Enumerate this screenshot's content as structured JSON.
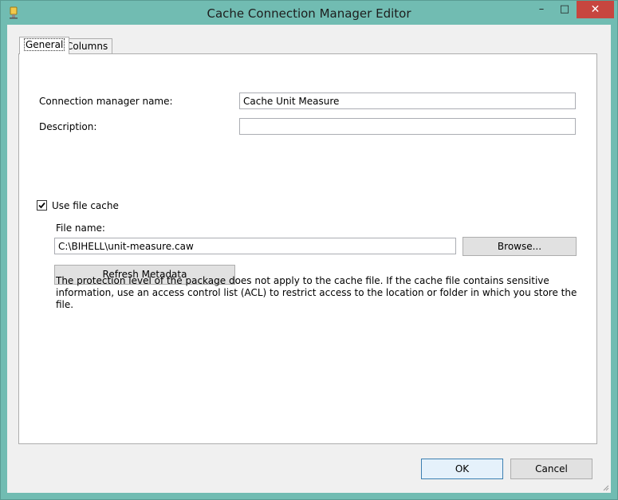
{
  "window": {
    "title": "Cache Connection Manager Editor",
    "minimize": "–",
    "maximize": "□",
    "close": "✕"
  },
  "tabs": [
    {
      "label": "General",
      "selected": true
    },
    {
      "label": "Columns",
      "selected": false
    }
  ],
  "general": {
    "name_label": "Connection manager name:",
    "name_value": "Cache Unit Measure",
    "description_label": "Description:",
    "description_value": "",
    "use_cache_label": "Use file cache",
    "use_cache_checked": true,
    "file_name_label": "File name:",
    "file_name_value": "C:\\BIHELL\\unit-measure.caw",
    "browse_label": "Browse...",
    "refresh_label": "Refresh Metadata",
    "info_text": "The protection level of the package does not apply to the cache file. If the cache file contains sensitive information, use an access control list (ACL) to restrict access to the location or folder in which you store the file."
  },
  "footer": {
    "ok_label": "OK",
    "cancel_label": "Cancel"
  },
  "colors": {
    "window_frame": "#71bcb2",
    "close_button": "#c7463f",
    "ok_border": "#3c7fb1"
  }
}
